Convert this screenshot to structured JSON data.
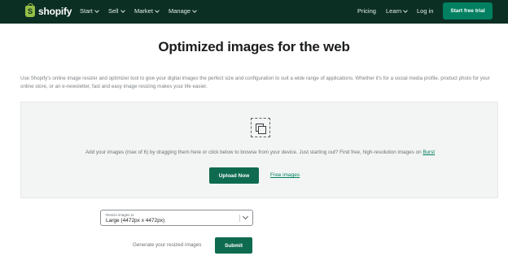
{
  "nav": {
    "logo_text": "shopify",
    "items": [
      {
        "label": "Start"
      },
      {
        "label": "Sell"
      },
      {
        "label": "Market"
      },
      {
        "label": "Manage"
      }
    ],
    "right": {
      "pricing": "Pricing",
      "learn": "Learn",
      "login": "Log in",
      "cta": "Start free trial"
    }
  },
  "page": {
    "title": "Optimized images for the web",
    "intro": "Use Shopify's online image resizer and optimizer tool to give your digital images the perfect size and configuration to suit a wide range of applications. Whether it's for a social media profile, product photo for your online store, or an e-newsletter, fast and easy image resizing makes your life easier."
  },
  "dropzone": {
    "icon": "images-icon",
    "text": "Add your images (max of 6) by dragging them here or click below to browse from your device. Just starting out? Find free, high-resolution images on",
    "burst_link": "Burst",
    "upload_label": "Upload Now",
    "free_images_label": "Free images"
  },
  "resize": {
    "label": "Resize images to",
    "value": "Large (4472px x 4472px)"
  },
  "footer": {
    "generate_text": "Generate your resized images",
    "submit_label": "Submit"
  },
  "colors": {
    "nav_bg": "#0c2f24",
    "brand_green": "#008060",
    "button_green": "#0f6b4f",
    "logo_green": "#95bf47"
  }
}
